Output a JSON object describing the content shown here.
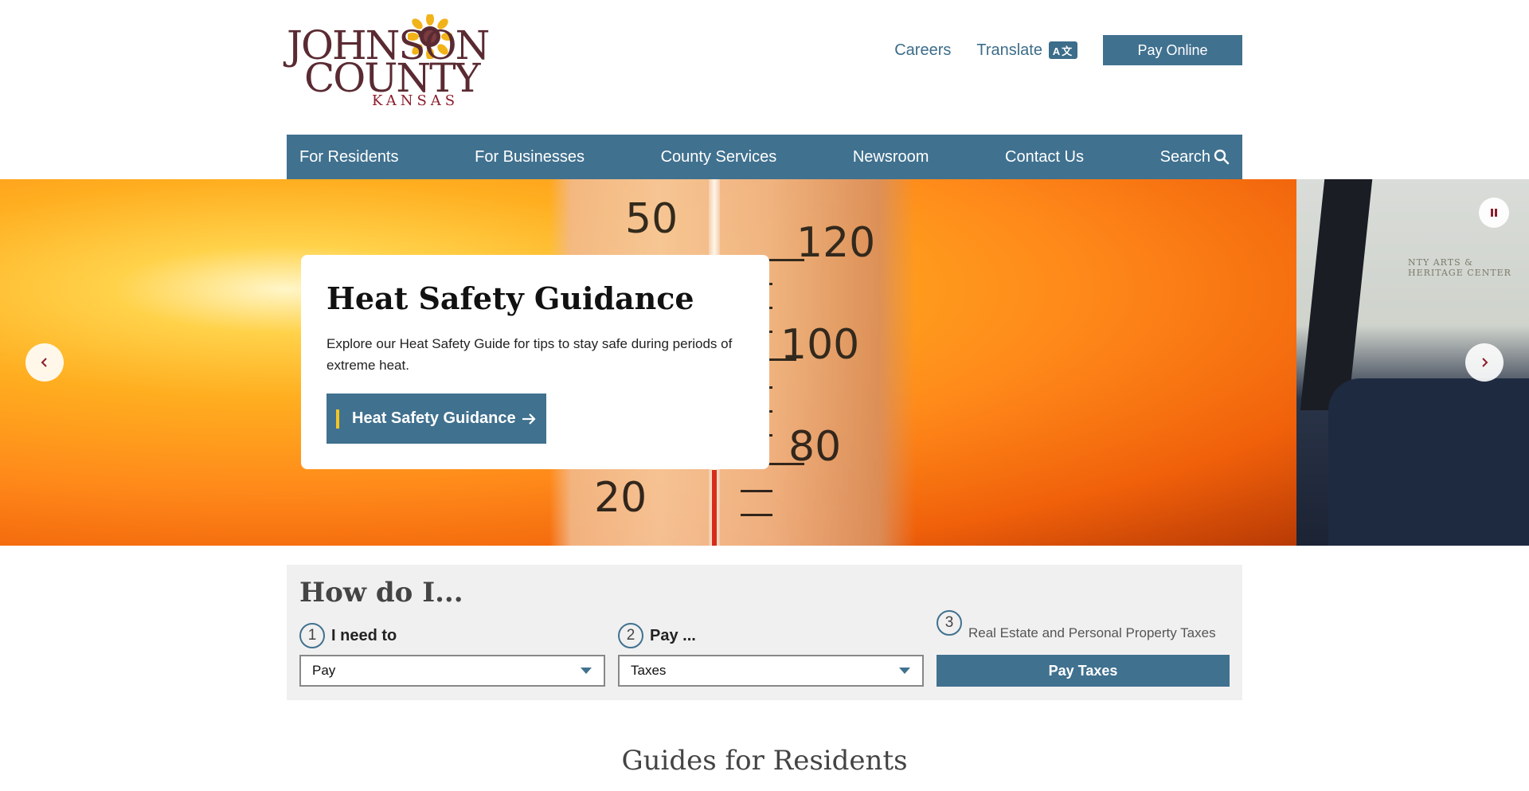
{
  "logo": {
    "line1": "JOHNSON",
    "line2": "COUNTY",
    "line3": "KANSAS"
  },
  "header": {
    "careers": "Careers",
    "translate": "Translate",
    "translate_icon_text": "A文",
    "pay_online": "Pay Online"
  },
  "nav": {
    "items": [
      "For Residents",
      "For Businesses",
      "County Services",
      "Newsroom",
      "Contact Us"
    ],
    "search": "Search"
  },
  "hero": {
    "title": "Heat Safety Guidance",
    "text": "Explore our Heat Safety Guide for tips to stay safe during periods of extreme heat.",
    "button": "Heat Safety Guidance",
    "thermo_numbers": [
      "50",
      "120",
      "100",
      "80",
      "20"
    ],
    "side_sign": "NTY ARTS & HERITAGE CENTER"
  },
  "howdo": {
    "title": "How do I...",
    "step1": {
      "num": "1",
      "label": "I need to",
      "value": "Pay"
    },
    "step2": {
      "num": "2",
      "label": "Pay ...",
      "value": "Taxes"
    },
    "step3": {
      "num": "3",
      "desc": "Real Estate and Personal Property Taxes",
      "button": "Pay Taxes"
    }
  },
  "guides": {
    "title": "Guides for Residents"
  },
  "colors": {
    "brand_blue": "#40718f",
    "accent_yellow": "#f2c523",
    "logo_maroon": "#5a2a32"
  }
}
